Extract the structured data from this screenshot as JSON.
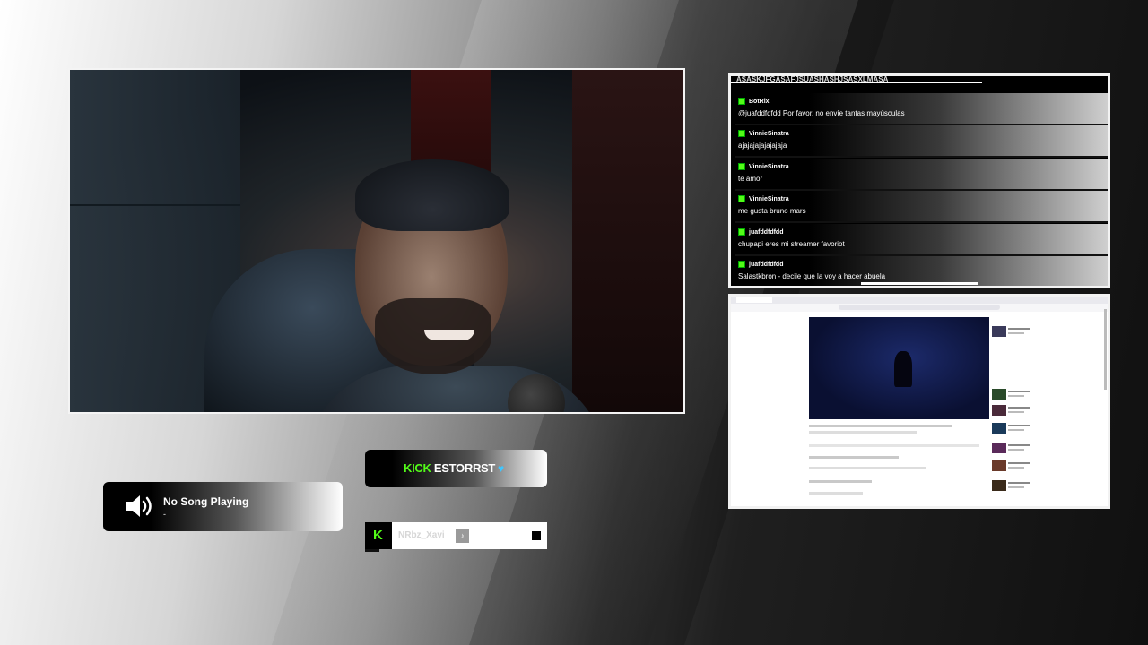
{
  "song": {
    "title": "No Song Playing",
    "artist": "-",
    "icon": "speaker-icon"
  },
  "kick_banner": {
    "platform": "KICK",
    "channel": "ESTORRST",
    "icon": "heart-icon"
  },
  "follow_alert": {
    "badge": "K",
    "username": "NRbz_Xavi",
    "tiktok_glyph": "♪"
  },
  "chat": {
    "cutoff_text": "ASASKJFGASAFJSUASHASHJSASXLMASA",
    "messages": [
      {
        "user": "BotRix",
        "text": "@juafddfdfdd Por favor, no envíe tantas mayúsculas"
      },
      {
        "user": "VinnieSinatra",
        "text": "ajajajajajajajaja"
      },
      {
        "user": "VinnieSinatra",
        "text": "te amor"
      },
      {
        "user": "VinnieSinatra",
        "text": "me gusta bruno mars"
      },
      {
        "user": "juafddfdfdd",
        "text": "chupapi eres mi streamer favoriot"
      },
      {
        "user": "juafddfdfdd",
        "text": "Salastkbron - decile que la voy a hacer abuela"
      }
    ]
  },
  "colors": {
    "kick_green": "#53fc18",
    "heart_blue": "#3fc6ff"
  }
}
